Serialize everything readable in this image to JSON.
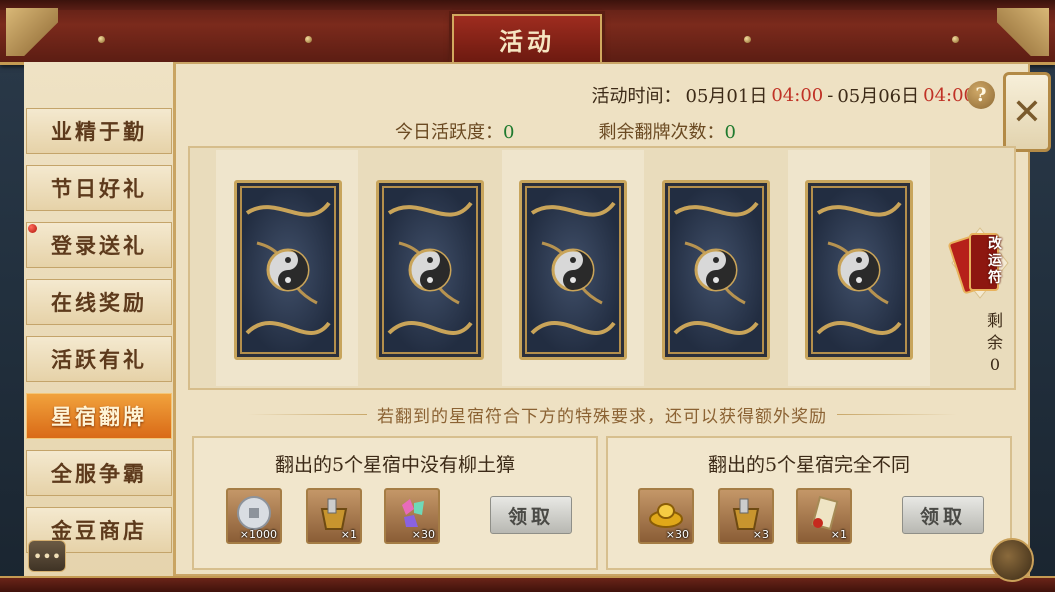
{
  "header": {
    "title": "活动"
  },
  "sidebar": {
    "items": [
      {
        "label": "业精于勤"
      },
      {
        "label": "节日好礼"
      },
      {
        "label": "登录送礼"
      },
      {
        "label": "在线奖励"
      },
      {
        "label": "活跃有礼"
      },
      {
        "label": "星宿翻牌"
      },
      {
        "label": "全服争霸"
      },
      {
        "label": "金豆商店"
      }
    ],
    "active_index": 5
  },
  "event_time": {
    "label": "活动时间：",
    "start_date": "05月01日",
    "start_time": "04:00",
    "separator": "-",
    "end_date": "05月06日",
    "end_time": "04:00"
  },
  "help_label": "?",
  "stats": {
    "activity_label": "今日活跃度：",
    "activity_value": "0",
    "flips_label": "剩余翻牌次数：",
    "flips_value": "0"
  },
  "gaiyun": {
    "label": "改运符",
    "remain_label": "剩余",
    "remain_value": "0"
  },
  "banner": "若翻到的星宿符合下方的特殊要求，还可以获得额外奖励",
  "rewards": [
    {
      "title": "翻出的5个星宿中没有柳土獐",
      "items": [
        {
          "name": "silver-coin-icon",
          "count": "×1000"
        },
        {
          "name": "basket-icon",
          "count": "×1"
        },
        {
          "name": "gems-icon",
          "count": "×30"
        }
      ],
      "claim": "领取"
    },
    {
      "title": "翻出的5个星宿完全不同",
      "items": [
        {
          "name": "gold-ingot-icon",
          "count": "×30"
        },
        {
          "name": "basket-icon",
          "count": "×3"
        },
        {
          "name": "scroll-icon",
          "count": "×1"
        }
      ],
      "claim": "领取"
    }
  ],
  "colors": {
    "accent_red": "#c03226",
    "active_tab": "#e07a1f",
    "green_value": "#1f7a2e",
    "parchment": "#eee1c3"
  }
}
